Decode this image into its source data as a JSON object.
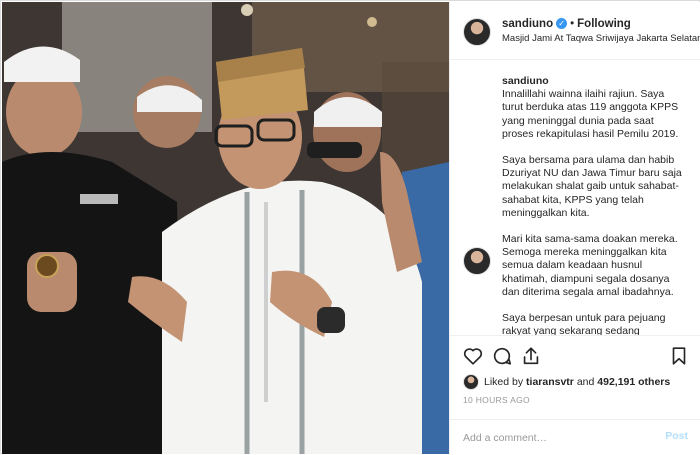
{
  "post": {
    "author": "sandiuno",
    "follow_state": "Following",
    "separator": "•",
    "location": "Masjid Jami At Taqwa Sriwijaya Jakarta Selatan"
  },
  "caption": {
    "user": "sandiuno",
    "paragraphs": [
      "Innalillahi wainna ilaihi rajiun. Saya turut berduka atas 119 anggota KPPS yang meninggal dunia pada saat proses rekapitulasi hasil Pemilu 2019.",
      "Saya bersama para ulama dan habib Dzuriyat NU dan Jawa Timur baru saja melakukan shalat gaib untuk sahabat-sahabat kita, KPPS yang telah meninggalkan kita.",
      "Mari kita sama-sama doakan mereka. Semoga mereka meninggalkan kita semua dalam keadaan husnul khatimah, diampuni segala dosanya dan diterima segala amal ibadahnya.",
      "Saya berpesan untuk para pejuang rakyat yang sekarang sedang"
    ]
  },
  "likes": {
    "prefix": "Liked by",
    "user": "tiaransvtr",
    "conjunction": "and",
    "count": "492,191 others"
  },
  "timestamp": "10 HOURS AGO",
  "comment_box": {
    "placeholder": "Add a comment…",
    "post_label": "Post"
  },
  "icons": {
    "like": "heart-icon",
    "comment": "comment-icon",
    "share": "share-icon",
    "save": "bookmark-icon",
    "verified": "verified-badge-icon"
  },
  "colors": {
    "verified": "#3897f0",
    "post_disabled": "#b2dffc",
    "muted": "#999999"
  }
}
